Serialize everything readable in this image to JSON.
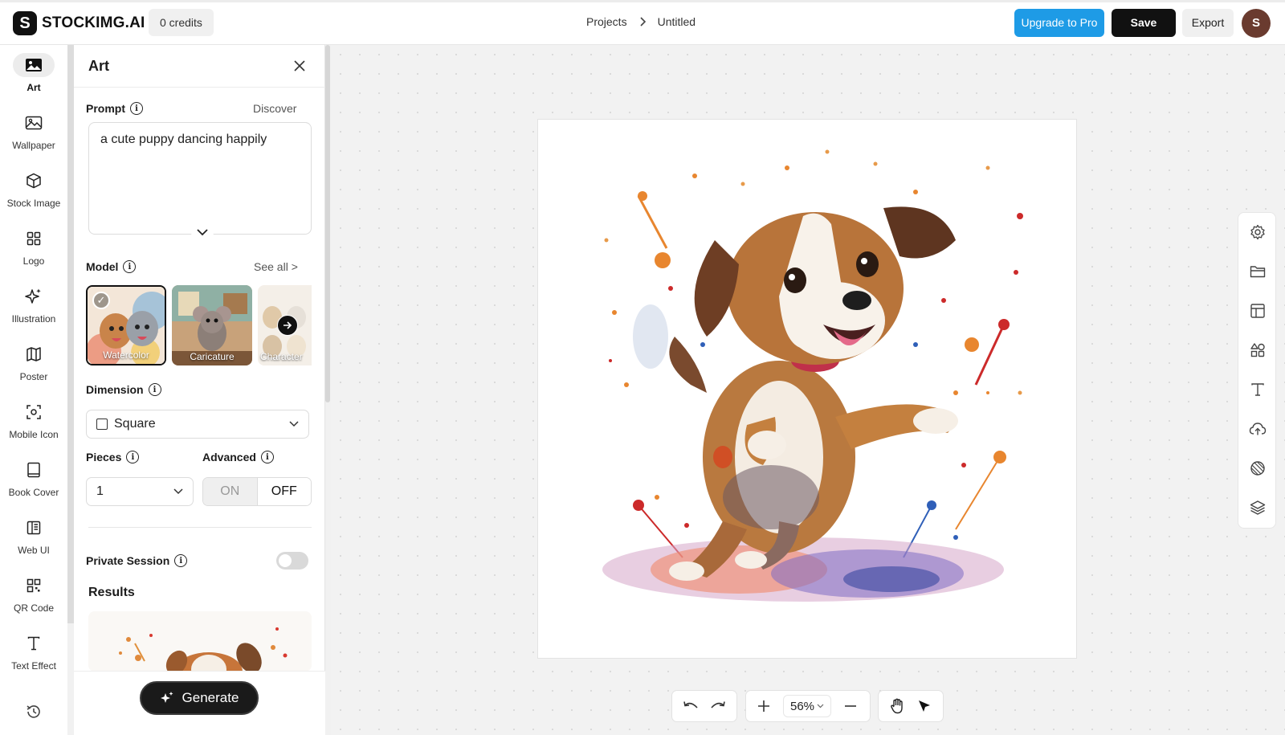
{
  "app": {
    "logo_letter": "S",
    "name": "STOCKIMG.AI"
  },
  "header": {
    "credits": "0 credits",
    "breadcrumb": {
      "root": "Projects",
      "separator": ">",
      "current": "Untitled"
    },
    "upgrade_label": "Upgrade to Pro",
    "save_label": "Save",
    "export_label": "Export",
    "avatar_initial": "S",
    "accent_color": "#1e9be6"
  },
  "sidebar": {
    "items": [
      {
        "label": "Art",
        "icon": "image-icon",
        "active": true
      },
      {
        "label": "Wallpaper",
        "icon": "landscape-icon"
      },
      {
        "label": "Stock Image",
        "icon": "cube-icon"
      },
      {
        "label": "Logo",
        "icon": "grid-icon"
      },
      {
        "label": "Illustration",
        "icon": "sparkle-icon"
      },
      {
        "label": "Poster",
        "icon": "map-icon"
      },
      {
        "label": "Mobile Icon",
        "icon": "focus-icon"
      },
      {
        "label": "Book Cover",
        "icon": "book-icon"
      },
      {
        "label": "Web UI",
        "icon": "layout-icon"
      },
      {
        "label": "QR Code",
        "icon": "qr-icon"
      },
      {
        "label": "Text Effect",
        "icon": "text-icon"
      }
    ],
    "history_icon": "history-icon"
  },
  "panel": {
    "title": "Art",
    "prompt": {
      "label": "Prompt",
      "link": "Discover",
      "value": "a cute puppy dancing happily"
    },
    "model": {
      "label": "Model",
      "link": "See all >",
      "options": [
        {
          "name": "Watercolor",
          "selected": true
        },
        {
          "name": "Caricature",
          "selected": false
        },
        {
          "name": "Character",
          "selected": false
        }
      ]
    },
    "dimension": {
      "label": "Dimension",
      "value": "Square"
    },
    "pieces": {
      "label": "Pieces",
      "value": "1"
    },
    "advanced": {
      "label": "Advanced",
      "on_label": "ON",
      "off_label": "OFF",
      "selected": "OFF"
    },
    "private_session": {
      "label": "Private Session",
      "enabled": false
    },
    "results_title": "Results",
    "generate_label": "Generate"
  },
  "canvas": {
    "zoom": "56%",
    "right_tools": [
      "settings-icon",
      "folder-icon",
      "template-icon",
      "shapes-icon",
      "text-icon",
      "upload-cloud-icon",
      "texture-icon",
      "layers-icon"
    ]
  }
}
